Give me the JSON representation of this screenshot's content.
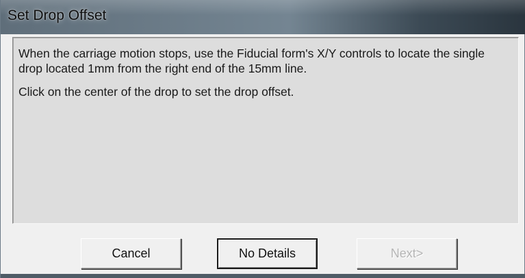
{
  "window": {
    "title": "Set Drop Offset"
  },
  "message": {
    "paragraph1": "When the carriage motion stops, use the Fiducial form's X/Y controls to locate the single drop located 1mm from the right end of the 15mm line.",
    "paragraph2": "Click on the center of the drop to set the drop offset."
  },
  "buttons": {
    "cancel_label": "Cancel",
    "no_details_label": "No Details",
    "next_label": "Next>",
    "next_enabled": false
  },
  "colors": {
    "panel_background": "#dddddd",
    "dialog_background": "#f0f0f0",
    "disabled_text": "#b5b5b5"
  }
}
